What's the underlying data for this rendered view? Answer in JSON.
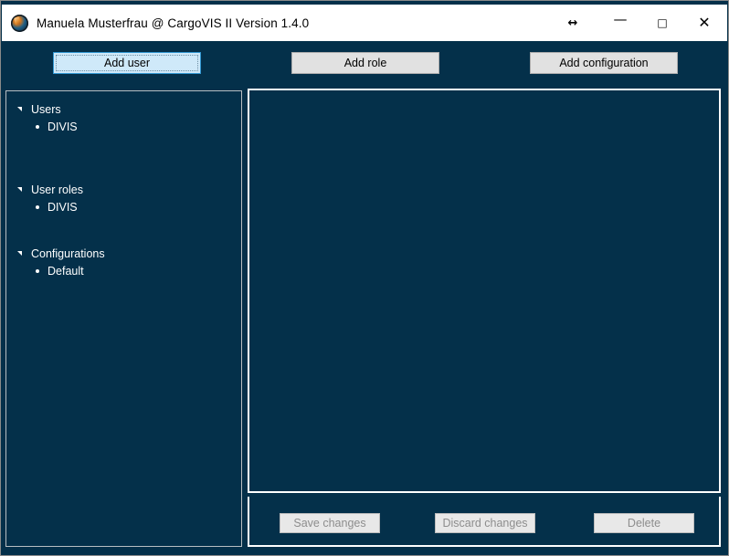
{
  "window": {
    "title": "Manuela Musterfrau @ CargoVIS II Version 1.4.0",
    "app_icon": "globe-icon",
    "background_color": "#04304a",
    "titlebar_color": "#ffffff",
    "border_color": "#8a8a8a",
    "controls": [
      {
        "name": "restore-size-button",
        "glyph": "↔",
        "label": "Resize"
      },
      {
        "name": "minimize-button",
        "glyph": "—",
        "label": "Minimize"
      },
      {
        "name": "maximize-button",
        "glyph": "□",
        "label": "Maximize"
      },
      {
        "name": "close-button",
        "glyph": "✕",
        "label": "Close"
      }
    ]
  },
  "toolbar": {
    "add_user_label": "Add user",
    "add_role_label": "Add role",
    "add_configuration_label": "Add configuration",
    "focused_button": "add-user-button",
    "focus_color": "#cfe9f9",
    "button_color": "#e1e1e1"
  },
  "sidebar": {
    "groups": [
      {
        "label": "Users",
        "expanded": true,
        "children": [
          {
            "label": "DIVIS"
          }
        ]
      },
      {
        "label": "User roles",
        "expanded": true,
        "children": [
          {
            "label": "DIVIS"
          }
        ]
      },
      {
        "label": "Configurations",
        "expanded": true,
        "children": [
          {
            "label": "Default"
          }
        ]
      }
    ]
  },
  "detail": {
    "content": ""
  },
  "actions": {
    "save_label": "Save changes",
    "discard_label": "Discard changes",
    "delete_label": "Delete",
    "disabled": true,
    "disabled_text_color": "#8d8d8d",
    "disabled_bg_color": "#e8e8e8"
  }
}
